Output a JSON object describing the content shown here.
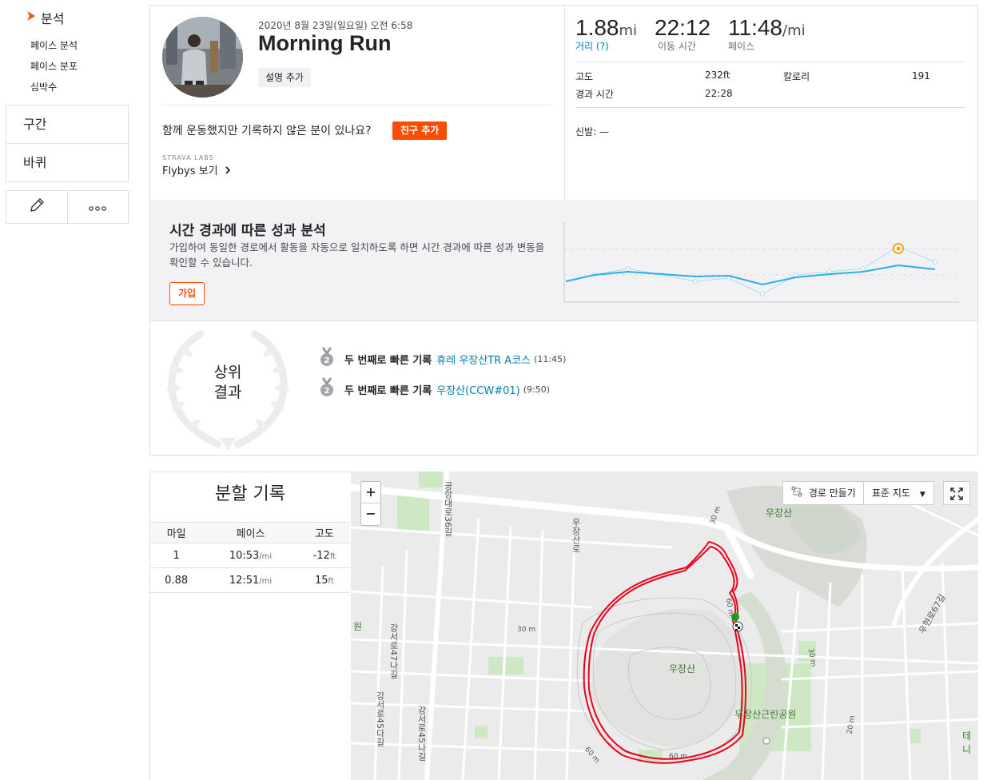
{
  "sidebar": {
    "analysis_label": "분석",
    "sub_items": [
      "페이스 분석",
      "페이스 분포",
      "심박수"
    ],
    "segments_label": "구간",
    "gear_label": "바퀴"
  },
  "activity": {
    "date": "2020년 8월 23일(일요일) 오전 6:58",
    "title": "Morning Run",
    "add_description": "설명 추가",
    "together_text": "함께 운동했지만 기록하지 않은 분이 있나요?",
    "add_friend": "친구 추가",
    "labs_label": "STRAVA LABS",
    "flyby_label": "Flybys 보기"
  },
  "stats": {
    "distance": "1.88",
    "distance_unit": "mi",
    "distance_label": "거리 (?)",
    "moving_time": "22:12",
    "moving_time_label": "이동 시간",
    "pace": "11:48",
    "pace_unit": "/mi",
    "pace_label": "페이스",
    "elevation_label": "고도",
    "elevation": "232ft",
    "calories_label": "칼로리",
    "calories": "191",
    "elapsed_label": "경과 시간",
    "elapsed": "22:28",
    "shoes": "신발: —"
  },
  "analysis": {
    "title": "시간 경과에 따른 성과 분석",
    "text": "가입하여 동일한 경로에서 활동을 자동으로 일치하도록 하면 시간 경과에 따른 성과 변동을 확인할 수 있습니다.",
    "join": "가입",
    "accent": "#fc4c02",
    "line_color": "#2ab0e6",
    "highlight_color": "#f7a21b"
  },
  "top_results": {
    "label_line1": "상위",
    "label_line2": "결과",
    "items": [
      {
        "rank": "2",
        "prefix": "두 번째로 빠른 기록",
        "segment": "휴레 우장산TR A코스",
        "time": "(11:45)"
      },
      {
        "rank": "2",
        "prefix": "두 번째로 빠른 기록",
        "segment": "우장산(CCW#01)",
        "time": "(9:50)"
      }
    ]
  },
  "splits": {
    "title": "분할 기록",
    "headers": [
      "마일",
      "페이스",
      "고도"
    ],
    "rows": [
      {
        "mile": "1",
        "pace": "10:53",
        "pace_unit": "/mi",
        "elev": "-12",
        "elev_unit": "ft"
      },
      {
        "mile": "0.88",
        "pace": "12:51",
        "pace_unit": "/mi",
        "elev": "15",
        "elev_unit": "ft"
      }
    ]
  },
  "map": {
    "zoom_in": "+",
    "zoom_out": "−",
    "route_builder": "경로 만들기",
    "map_type": "표준 지도",
    "labels": {
      "ujangsan1": "우장산",
      "ujangsan2": "우장산",
      "park": "우장산근린공원",
      "road1": "공항대로36길",
      "road2": "우장산로",
      "road3": "강서로47나길",
      "road4": "강서로45다길",
      "road5": "강서로45나길",
      "road6": "우현로67길",
      "c30a": "30 m",
      "c30b": "30 m",
      "c30c": "30 m",
      "c60a": "60 m",
      "c60b": "60 m",
      "c60c": "60 m",
      "c20": "20 m",
      "edge1": "원",
      "edge2": "테니"
    },
    "route_color": "#e8001c"
  }
}
